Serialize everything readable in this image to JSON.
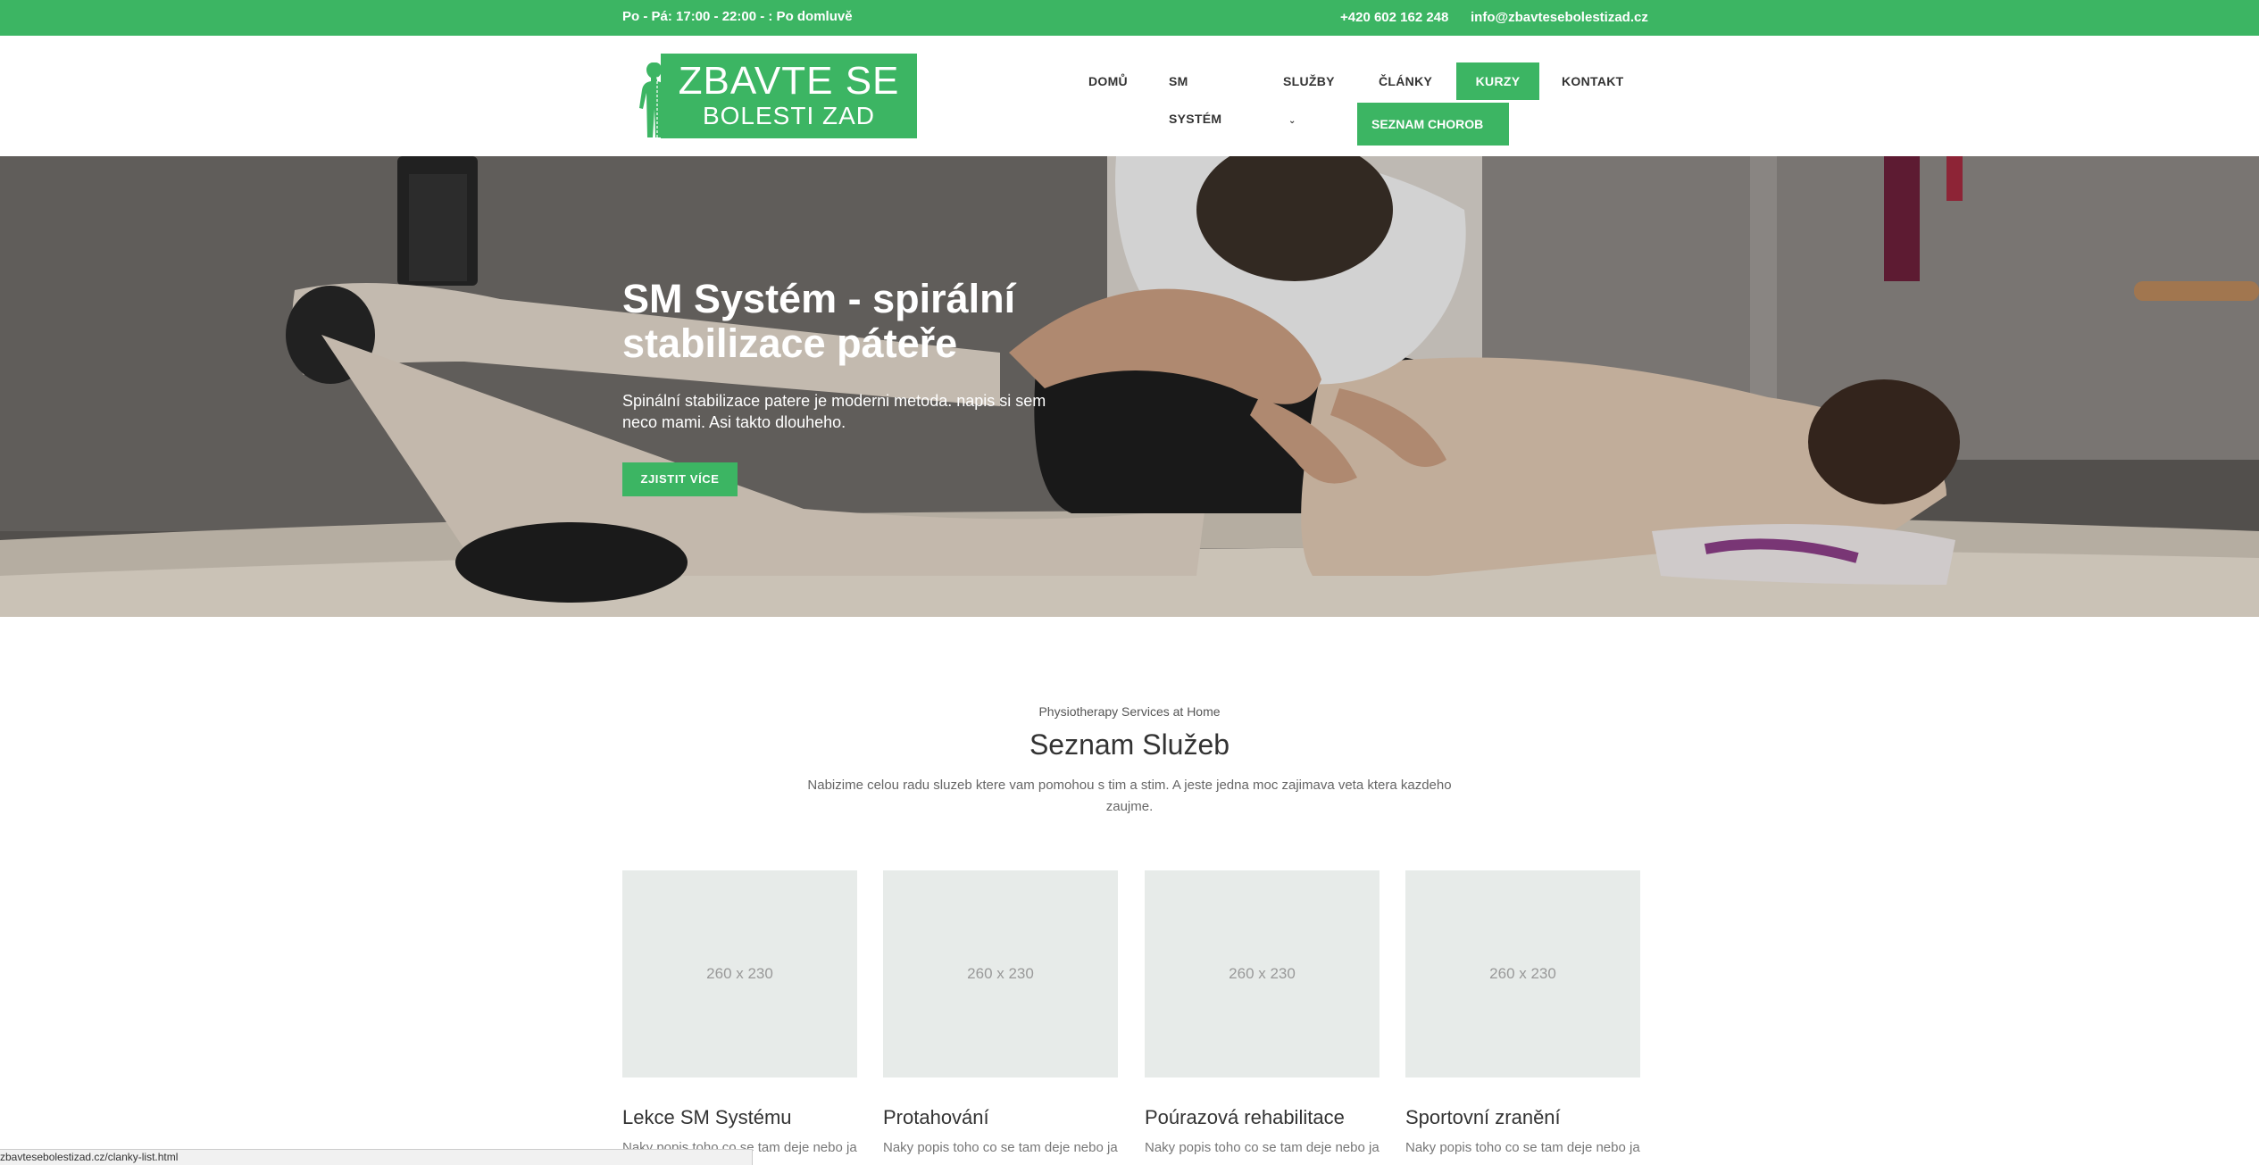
{
  "topbar": {
    "hours": "Po - Pá: 17:00 - 22:00 - : Po domluvě",
    "phone": "+420 602 162 248",
    "email": "info@zbavtesebolestizad.cz"
  },
  "logo": {
    "line1": "ZBAVTE SE",
    "line2": "BOLESTI ZAD"
  },
  "nav": {
    "home": "DOMŮ",
    "sm_system": "SM SYSTÉM",
    "services": "SLUŽBY",
    "articles": "ČLÁNKY",
    "courses": "KURZY",
    "contact": "KONTAKT",
    "submenu_item": "SEZNAM CHOROB"
  },
  "hero": {
    "title": "SM Systém - spirální stabilizace páteře",
    "text": "Spinální stabilizace patere je moderni metoda. napis si sem neco mami. Asi takto dlouheho.",
    "button": "ZJISTIT VÍCE"
  },
  "services": {
    "subtitle": "Physiotherapy Services at Home",
    "title": "Seznam Služeb",
    "description": "Nabizime celou radu sluzeb ktere vam pomohou s tim a stim. A jeste jedna moc zajimava veta ktera kazdeho zaujme.",
    "cards": [
      {
        "image": "260 x 230",
        "title": "Lekce SM Systému",
        "desc": "Naky popis toho co se tam deje nebo ja"
      },
      {
        "image": "260 x 230",
        "title": "Protahování",
        "desc": "Naky popis toho co se tam deje nebo ja"
      },
      {
        "image": "260 x 230",
        "title": "Poúrazová rehabilitace",
        "desc": "Naky popis toho co se tam deje nebo ja"
      },
      {
        "image": "260 x 230",
        "title": "Sportovní zranění",
        "desc": "Naky popis toho co se tam deje nebo ja"
      }
    ]
  },
  "statusbar": {
    "url": "zbavtesebolestizad.cz/clanky-list.html"
  },
  "colors": {
    "brand": "#3cb563",
    "placeholder": "#e7ebe9"
  }
}
